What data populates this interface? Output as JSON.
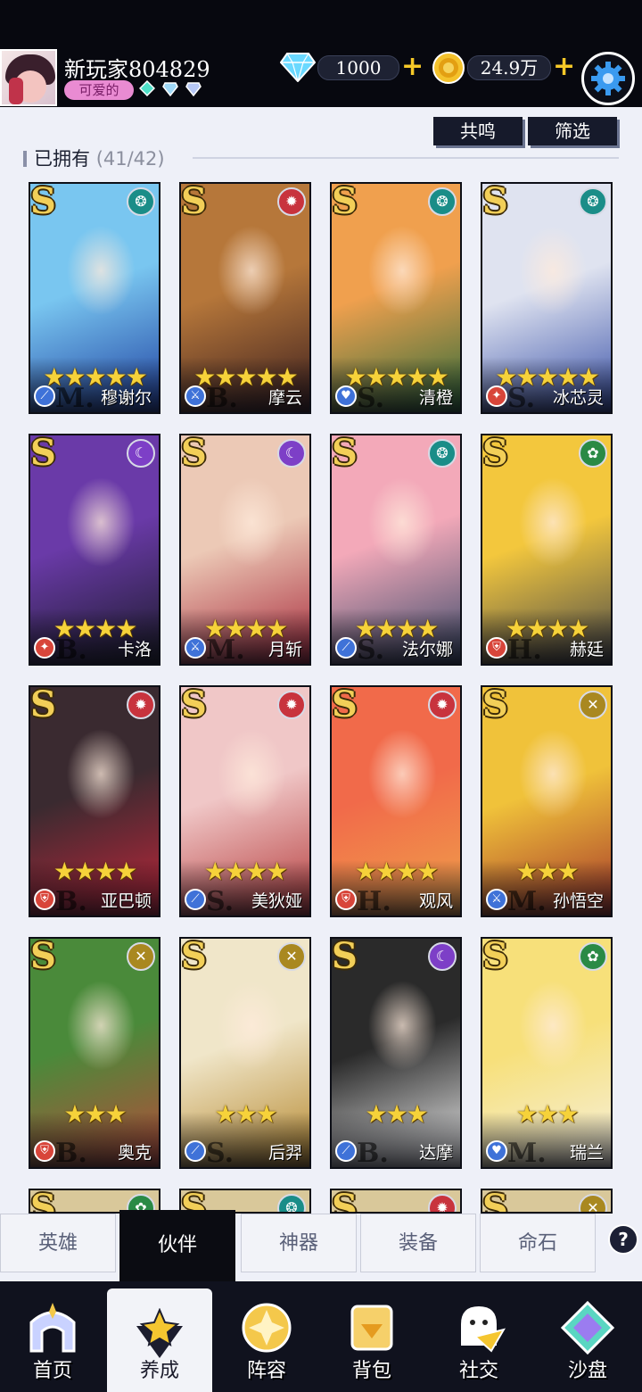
{
  "player": {
    "name": "新玩家804829",
    "title": "可爱的"
  },
  "resources": {
    "gems": "1000",
    "gold": "24.9万"
  },
  "filters": {
    "resonance": "共鸣",
    "filter": "筛选"
  },
  "owned": {
    "label": "已拥有",
    "count": "(41/42)"
  },
  "colors": {
    "fire": "#c8333d",
    "water": "#1a8d88",
    "moon": "#7d3fc7",
    "nature": "#2a8a45",
    "light": "#a98820",
    "role_blue": "#3f72d8",
    "role_red": "#d8453a",
    "role_pink": "#e05b8e"
  },
  "heroes": [
    {
      "name": "穆谢尔",
      "rank": "S",
      "element": "water",
      "element_icon": "swirl-icon",
      "stars": "★★★★★",
      "role_icon": "staff-icon",
      "letter": "M."
    },
    {
      "name": "摩云",
      "rank": "S",
      "element": "fire",
      "element_icon": "flame-icon",
      "stars": "★★★★★",
      "role_icon": "sword-icon",
      "letter": "B."
    },
    {
      "name": "清橙",
      "rank": "S",
      "element": "water",
      "element_icon": "swirl-icon",
      "stars": "★★★★★",
      "role_icon": "heart-icon",
      "letter": "S."
    },
    {
      "name": "冰芯灵",
      "rank": "S",
      "element": "water",
      "element_icon": "swirl-icon",
      "stars": "★★★★★",
      "role_icon": "wand-icon",
      "letter": "S."
    },
    {
      "name": "卡洛",
      "rank": "S",
      "element": "moon",
      "element_icon": "moon-icon",
      "stars": "★★★★",
      "role_icon": "wand-icon",
      "letter": "B."
    },
    {
      "name": "月斩",
      "rank": "S",
      "element": "moon",
      "element_icon": "moon-icon",
      "stars": "★★★★",
      "role_icon": "sword-icon",
      "letter": "M."
    },
    {
      "name": "法尔娜",
      "rank": "S",
      "element": "water",
      "element_icon": "swirl-icon",
      "stars": "★★★★",
      "role_icon": "staff-icon",
      "letter": "S."
    },
    {
      "name": "赫廷",
      "rank": "S",
      "element": "nature",
      "element_icon": "leaf-icon",
      "stars": "★★★★",
      "role_icon": "shield-icon",
      "letter": "H."
    },
    {
      "name": "亚巴顿",
      "rank": "S",
      "element": "fire",
      "element_icon": "flame-icon",
      "stars": "★★★★",
      "role_icon": "shield-icon",
      "letter": "B."
    },
    {
      "name": "美狄娅",
      "rank": "S",
      "element": "fire",
      "element_icon": "flame-icon",
      "stars": "★★★★",
      "role_icon": "staff-icon",
      "letter": "S."
    },
    {
      "name": "观风",
      "rank": "S",
      "element": "fire",
      "element_icon": "flame-icon",
      "stars": "★★★★",
      "role_icon": "shield-icon",
      "letter": "H."
    },
    {
      "name": "孙悟空",
      "rank": "S",
      "element": "light",
      "element_icon": "cross-icon",
      "stars": "★★★",
      "role_icon": "sword-icon",
      "letter": "M."
    },
    {
      "name": "奥克",
      "rank": "S",
      "element": "light",
      "element_icon": "cross-icon",
      "stars": "★★★",
      "role_icon": "shield-icon",
      "letter": "B."
    },
    {
      "name": "后羿",
      "rank": "S",
      "element": "light",
      "element_icon": "cross-icon",
      "stars": "★★★",
      "role_icon": "staff-icon",
      "letter": "S."
    },
    {
      "name": "达摩",
      "rank": "S",
      "element": "moon",
      "element_icon": "moon-icon",
      "stars": "★★★",
      "role_icon": "staff-icon",
      "letter": "B."
    },
    {
      "name": "瑞兰",
      "rank": "S",
      "element": "nature",
      "element_icon": "leaf-icon",
      "stars": "★★★",
      "role_icon": "heart-icon",
      "letter": "M."
    }
  ],
  "partial_row": [
    {
      "rank": "S",
      "element": "nature"
    },
    {
      "rank": "S",
      "element": "water"
    },
    {
      "rank": "S",
      "element": "fire"
    },
    {
      "rank": "S",
      "element": "light"
    }
  ],
  "tabs": [
    {
      "label": "英雄",
      "active": false
    },
    {
      "label": "伙伴",
      "active": true
    },
    {
      "label": "神器",
      "active": false
    },
    {
      "label": "装备",
      "active": false
    },
    {
      "label": "命石",
      "active": false
    }
  ],
  "help": "?",
  "nav": [
    {
      "label": "首页",
      "icon": "home-icon",
      "active": false
    },
    {
      "label": "养成",
      "icon": "star-triangle-icon",
      "active": true
    },
    {
      "label": "阵容",
      "icon": "formation-icon",
      "active": false
    },
    {
      "label": "背包",
      "icon": "bag-icon",
      "active": false
    },
    {
      "label": "社交",
      "icon": "ghost-mail-icon",
      "active": false
    },
    {
      "label": "沙盘",
      "icon": "sandbox-icon",
      "active": false
    }
  ]
}
